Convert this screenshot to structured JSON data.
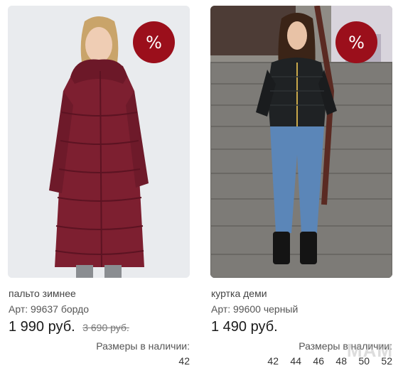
{
  "products": [
    {
      "name": "пальто зимнее",
      "article": "Арт: 99637 бордо",
      "price": "1 990 руб.",
      "old_price": "3 690 руб.",
      "badge": "%",
      "sizes_label": "Размеры в наличии:",
      "sizes": [
        "42"
      ]
    },
    {
      "name": "куртка деми",
      "article": "Арт: 99600 черный",
      "price": "1 490 руб.",
      "old_price": "",
      "badge": "%",
      "sizes_label": "Размеры в наличии:",
      "sizes": [
        "42",
        "44",
        "46",
        "48",
        "50",
        "52"
      ]
    }
  ],
  "colors": {
    "badge": "#9b0f1b",
    "coat": "#7d1f30",
    "jacket": "#1f2224",
    "jeans": "#5b86b8"
  },
  "watermark": "МАМ"
}
